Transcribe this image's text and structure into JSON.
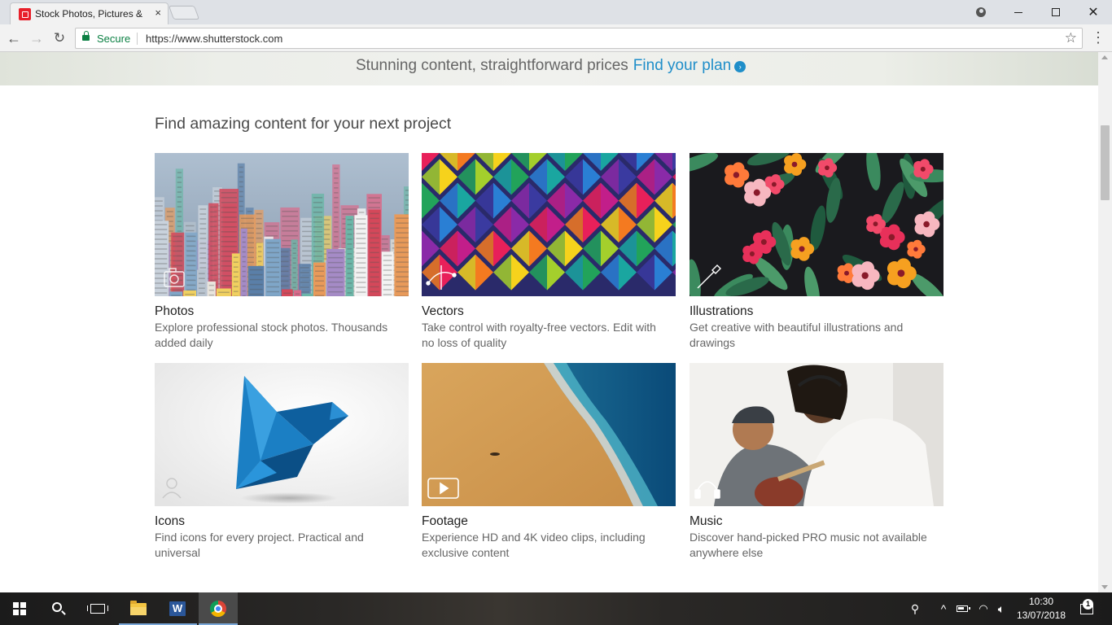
{
  "browser": {
    "tab_title": "Stock Photos, Pictures & Royalty-Free Images",
    "tab_close": "×",
    "secure_label": "Secure",
    "url": "https://www.shutterstock.com"
  },
  "banner": {
    "text": "Stunning content, straightforward prices",
    "link": "Find your plan"
  },
  "section": {
    "heading": "Find amazing content for your next project"
  },
  "cards": [
    {
      "title": "Photos",
      "description": "Explore professional stock photos. Thousands added daily",
      "icon": "camera-icon"
    },
    {
      "title": "Vectors",
      "description": "Take control with royalty-free vectors. Edit with no loss of quality",
      "icon": "vector-pen-icon"
    },
    {
      "title": "Illustrations",
      "description": "Get creative with beautiful illustrations and drawings",
      "icon": "brush-icon"
    },
    {
      "title": "Icons",
      "description": "Find icons for every project. Practical and universal",
      "icon": "person-icon"
    },
    {
      "title": "Footage",
      "description": "Experience HD and 4K video clips, including exclusive content",
      "icon": "play-icon"
    },
    {
      "title": "Music",
      "description": "Discover hand-picked PRO music not available anywhere else",
      "icon": "headphones-icon"
    }
  ],
  "taskbar": {
    "time": "10:30",
    "date": "13/07/2018",
    "notification_count": "1"
  }
}
